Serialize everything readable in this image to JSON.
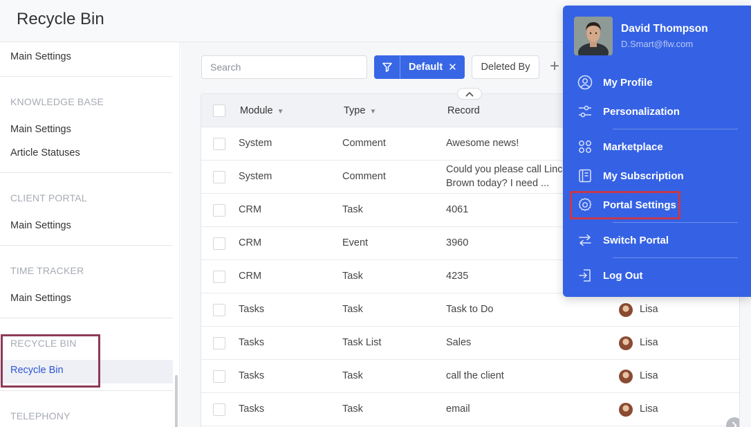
{
  "page": {
    "title": "Recycle Bin"
  },
  "sidebar": {
    "sections": [
      {
        "heading": "",
        "items": [
          "Main Settings"
        ]
      },
      {
        "heading": "KNOWLEDGE BASE",
        "items": [
          "Main Settings",
          "Article Statuses"
        ]
      },
      {
        "heading": "CLIENT PORTAL",
        "items": [
          "Main Settings"
        ]
      },
      {
        "heading": "TIME TRACKER",
        "items": [
          "Main Settings"
        ]
      },
      {
        "heading": "RECYCLE BIN",
        "items": [
          "Recycle Bin"
        ]
      },
      {
        "heading": "TELEPHONY",
        "items": []
      }
    ],
    "active_item": "Recycle Bin"
  },
  "toolbar": {
    "search_placeholder": "Search",
    "filter_label": "Default",
    "deleted_by_label": "Deleted By",
    "add_label": "+"
  },
  "table": {
    "columns": [
      "Module",
      "Type",
      "Record"
    ],
    "rows": [
      {
        "module": "System",
        "type": "Comment",
        "record": "Awesome news!",
        "user": ""
      },
      {
        "module": "System",
        "type": "Comment",
        "record": "Could you please call Linc",
        "record2": "Brown today? I need ...",
        "user": ""
      },
      {
        "module": "CRM",
        "type": "Task",
        "record": "4061",
        "user": ""
      },
      {
        "module": "CRM",
        "type": "Event",
        "record": "3960",
        "user": ""
      },
      {
        "module": "CRM",
        "type": "Task",
        "record": "4235",
        "user": ""
      },
      {
        "module": "Tasks",
        "type": "Task",
        "record": "Task to Do",
        "user": "Lisa"
      },
      {
        "module": "Tasks",
        "type": "Task List",
        "record": "Sales",
        "user": "Lisa"
      },
      {
        "module": "Tasks",
        "type": "Task",
        "record": "call the client",
        "user": "Lisa"
      },
      {
        "module": "Tasks",
        "type": "Task",
        "record": "email",
        "user": "Lisa"
      }
    ]
  },
  "user_menu": {
    "name": "David Thompson",
    "email": "D.Smart@flw.com",
    "items": [
      {
        "label": "My Profile",
        "icon": "user-circle-icon"
      },
      {
        "label": "Personalization",
        "icon": "sliders-icon"
      },
      {
        "label": "Marketplace",
        "icon": "grid-icon"
      },
      {
        "label": "My Subscription",
        "icon": "subscription-icon"
      },
      {
        "label": "Portal Settings",
        "icon": "gear-icon"
      },
      {
        "label": "Switch Portal",
        "icon": "switch-arrows-icon"
      },
      {
        "label": "Log Out",
        "icon": "logout-icon"
      }
    ],
    "highlighted_item": "Portal Settings"
  },
  "colors": {
    "accent": "#3867e6",
    "menu_bg": "#3562e4",
    "highlight_red": "#c43a4e",
    "highlight_plum": "#8e3a57"
  }
}
